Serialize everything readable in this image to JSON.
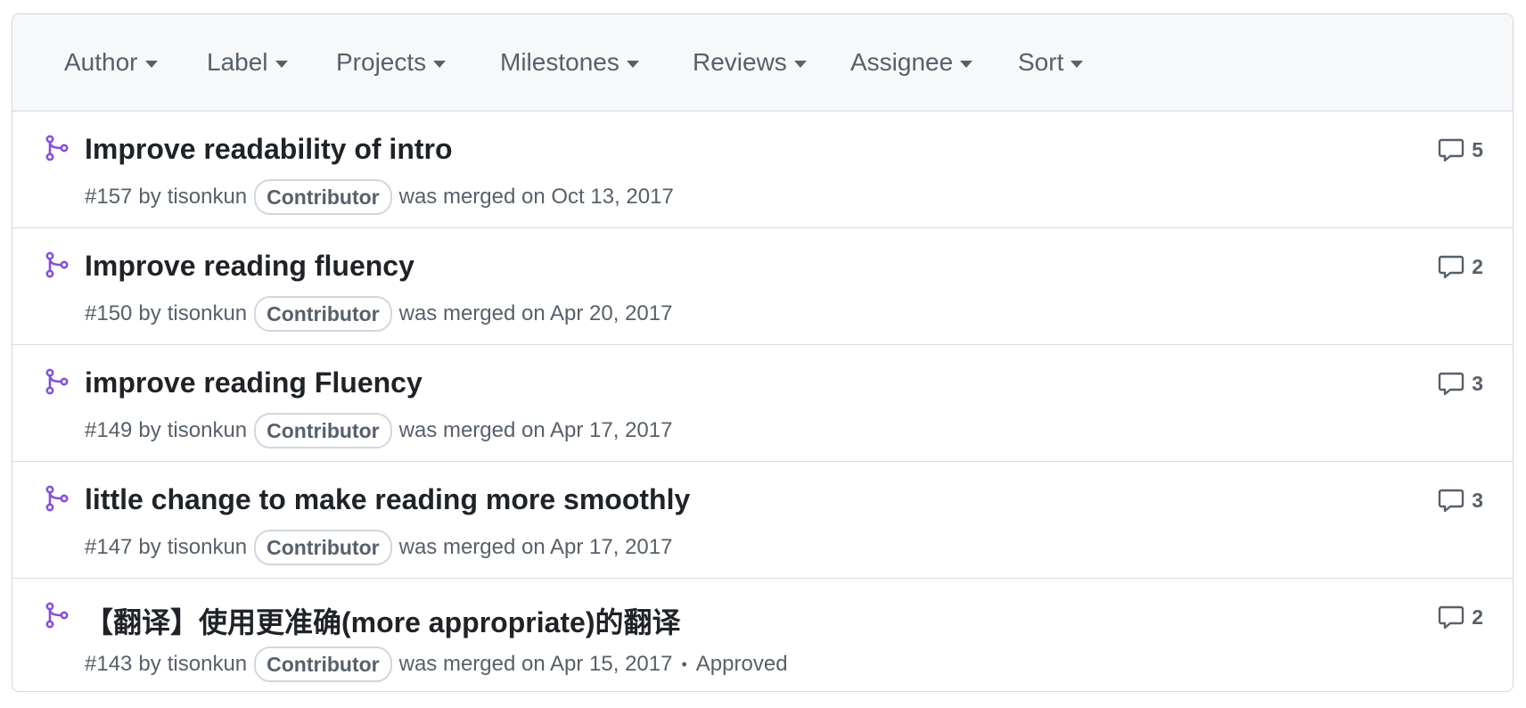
{
  "filters": [
    "Author",
    "Label",
    "Projects",
    "Milestones",
    "Reviews",
    "Assignee",
    "Sort"
  ],
  "accent_color": "#8250df",
  "pull_requests": [
    {
      "title": "Improve readability of intro",
      "number": "#157",
      "by": "by",
      "author": "tisonkun",
      "role": "Contributor",
      "status": "was merged on Oct 13, 2017",
      "review": "",
      "comments": "5"
    },
    {
      "title": "Improve reading fluency",
      "number": "#150",
      "by": "by",
      "author": "tisonkun",
      "role": "Contributor",
      "status": "was merged on Apr 20, 2017",
      "review": "",
      "comments": "2"
    },
    {
      "title": "improve reading Fluency",
      "number": "#149",
      "by": "by",
      "author": "tisonkun",
      "role": "Contributor",
      "status": "was merged on Apr 17, 2017",
      "review": "",
      "comments": "3"
    },
    {
      "title": "little change to make reading more smoothly",
      "number": "#147",
      "by": "by",
      "author": "tisonkun",
      "role": "Contributor",
      "status": "was merged on Apr 17, 2017",
      "review": "",
      "comments": "3"
    },
    {
      "title": "【翻译】使用更准确(more appropriate)的翻译",
      "number": "#143",
      "by": "by",
      "author": "tisonkun",
      "role": "Contributor",
      "status": "was merged on Apr 15, 2017",
      "review": "Approved",
      "comments": "2"
    }
  ]
}
